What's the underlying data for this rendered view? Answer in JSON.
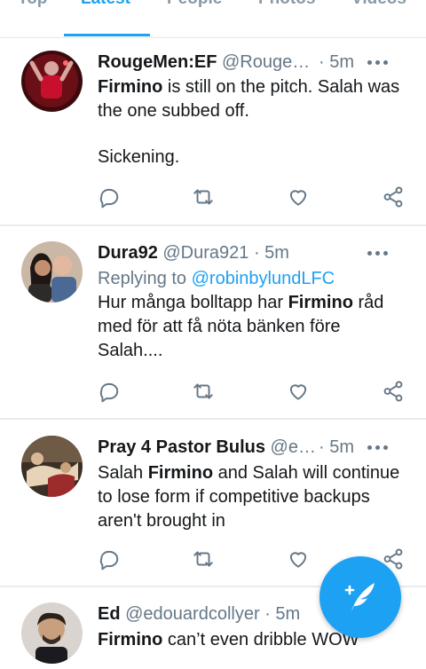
{
  "tabs": [
    {
      "label": "Top"
    },
    {
      "label": "Latest"
    },
    {
      "label": "People"
    },
    {
      "label": "Photos"
    },
    {
      "label": "Videos"
    }
  ],
  "tweets": [
    {
      "name": "RougeMen:EF",
      "handle": "@Rouge…",
      "time": "· 5m",
      "body_parts": [
        {
          "bold": "Firmino"
        },
        {
          "text": " is still on the pitch. Salah was the one subbed off."
        },
        {
          "text2": "Sickening."
        }
      ]
    },
    {
      "name": "Dura92",
      "handle": "@Dura921",
      "time": "· 5m",
      "replying_prefix": "Replying to",
      "replying_to": "@robinbylundLFC",
      "body_a": "Hur många bolltapp har ",
      "body_bold": "Firmino",
      "body_b": " råd med för att få nöta bänken före Salah...."
    },
    {
      "name": "Pray 4 Pastor Bulus",
      "handle": "@e…",
      "time": "· 5m",
      "body_a": "Salah ",
      "body_bold": "Firmino",
      "body_b": " and Salah will continue to lose form if competitive backups aren't brought in"
    },
    {
      "name": "Ed",
      "handle": "@edouardcollyer",
      "time": "· 5m",
      "body_bold": "Firmino",
      "body_b": " can’t even dribble WOW"
    }
  ],
  "icons": {
    "reply": "reply-icon",
    "retweet": "retweet-icon",
    "like": "heart-icon",
    "share": "share-icon",
    "compose": "compose-tweet-icon"
  },
  "colors": {
    "accent": "#1da1f2",
    "text": "#14171a",
    "muted": "#657786"
  }
}
